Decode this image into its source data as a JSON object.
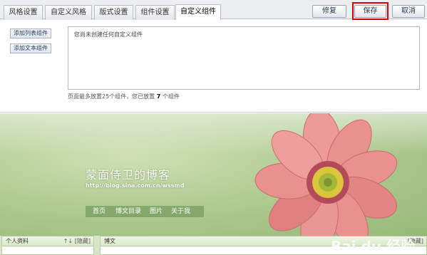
{
  "tabs": [
    {
      "label": "风格设置"
    },
    {
      "label": "自定义风格"
    },
    {
      "label": "版式设置"
    },
    {
      "label": "组件设置"
    },
    {
      "label": "自定义组件"
    }
  ],
  "toolbar": {
    "repair_label": "修复",
    "save_label": "保存",
    "cancel_label": "取消"
  },
  "sidebar": {
    "add_list_label": "添加列表组件",
    "add_text_label": "添加文本组件"
  },
  "editor": {
    "empty_text": "您尚未创建任何自定义组件"
  },
  "hint": {
    "prefix": "页面最多放置25个组件，您已放置",
    "count": "7",
    "suffix": "个组件"
  },
  "blog": {
    "title": "蒙面侍卫的博客",
    "url": "http://blog.sina.com.cn/wssmd",
    "nav": [
      "首页",
      "博文目录",
      "图片",
      "关于我"
    ]
  },
  "profile_box": {
    "title": "个人资料",
    "arrows": "↑↓",
    "hide_label": "[隐藏]"
  },
  "post_box": {
    "title": "博文",
    "hide_label": "[隐藏]"
  },
  "watermark": {
    "brand": "Bai du 经验",
    "url": "jingyan.baidu.com"
  },
  "colors": {
    "highlight": "#e00000",
    "banner_green": "#b1cc92",
    "petal_pink": "#e88b8b"
  }
}
